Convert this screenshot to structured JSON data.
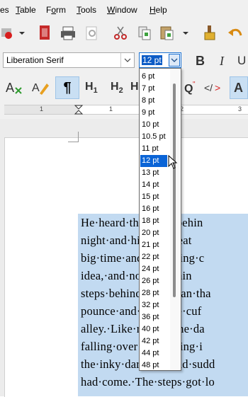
{
  "menu": {
    "items": [
      {
        "label": "es",
        "underline_char": ""
      },
      {
        "label": "Table",
        "underline_char": "T"
      },
      {
        "label": "Form",
        "underline_char": "o"
      },
      {
        "label": "Tools",
        "underline_char": "T"
      },
      {
        "label": "Window",
        "underline_char": "W"
      },
      {
        "label": "Help",
        "underline_char": "H"
      }
    ]
  },
  "font": {
    "name": "Liberation Serif",
    "size_value": "12 pt"
  },
  "size_dropdown": {
    "options": [
      "6 pt",
      "7 pt",
      "8 pt",
      "9 pt",
      "10 pt",
      "10.5 pt",
      "11 pt",
      "12 pt",
      "13 pt",
      "14 pt",
      "15 pt",
      "16 pt",
      "18 pt",
      "20 pt",
      "21 pt",
      "22 pt",
      "24 pt",
      "26 pt",
      "28 pt",
      "32 pt",
      "36 pt",
      "40 pt",
      "42 pt",
      "44 pt",
      "48 pt"
    ],
    "selected": "12 pt"
  },
  "styles_toolbar": {
    "h1": "H1",
    "h2": "H2",
    "h3": "H"
  },
  "ruler": {
    "marks": [
      "1",
      "1",
      "2",
      "3"
    ]
  },
  "document": {
    "lines": [
      "He·heard·the·steps·behin",
      "night·and·his·deadbeat",
      "big·time·and·is·making·c",
      "idea,·and·now·watchin",
      "steps·behind·can·mean·tha",
      "pounce·and·go·those·cuf",
      "alley.·Like·running·he·da",
      "falling·over·a·bin·lying·i",
      "the·inky·darkness·and·sudd",
      "had·come.·The·steps·got·lo"
    ]
  },
  "colors": {
    "selection": "#c2daf1",
    "dropdown_selected": "#0a64d6",
    "accent_border": "#1e73d2"
  }
}
